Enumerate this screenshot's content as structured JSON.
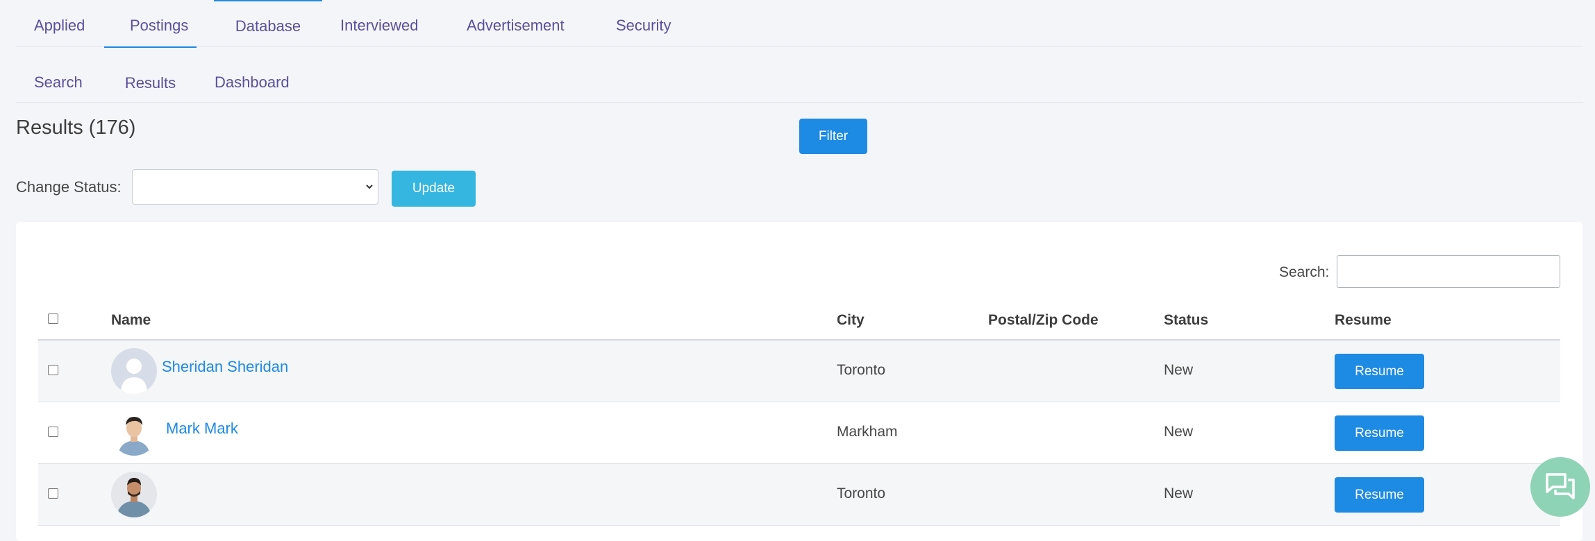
{
  "tabs": [
    {
      "label": "Applied"
    },
    {
      "label": "Postings"
    },
    {
      "label": "Database"
    },
    {
      "label": "Interviewed"
    },
    {
      "label": "Advertisement"
    },
    {
      "label": "Security"
    }
  ],
  "subtabs": [
    {
      "label": "Search"
    },
    {
      "label": "Results"
    },
    {
      "label": "Dashboard"
    }
  ],
  "results": {
    "title": "Results (176)",
    "filter_label": "Filter"
  },
  "status_control": {
    "label": "Change Status:",
    "selected": "",
    "update_label": "Update"
  },
  "table": {
    "search_label": "Search:",
    "search_value": "",
    "columns": [
      "Name",
      "City",
      "Postal/Zip Code",
      "Status",
      "Resume"
    ],
    "rows": [
      {
        "name": "Sheridan Sheridan",
        "city": "Toronto",
        "postal": "",
        "status": "New",
        "resume": "Resume",
        "avatar": "placeholder-avatar"
      },
      {
        "name": "Mark Mark",
        "city": "Markham",
        "postal": "",
        "status": "New",
        "resume": "Resume",
        "avatar": "man-photo-avatar"
      },
      {
        "name": "",
        "city": "Toronto",
        "postal": "",
        "status": "New",
        "resume": "Resume",
        "avatar": "man-photo-avatar"
      }
    ]
  },
  "colors": {
    "accent": "#1d8ae3",
    "update": "#35b6e0",
    "tab_text": "#5b4f9c",
    "chat": "#8fd3b6"
  },
  "chat_widget": {
    "icon": "chat-icon"
  }
}
